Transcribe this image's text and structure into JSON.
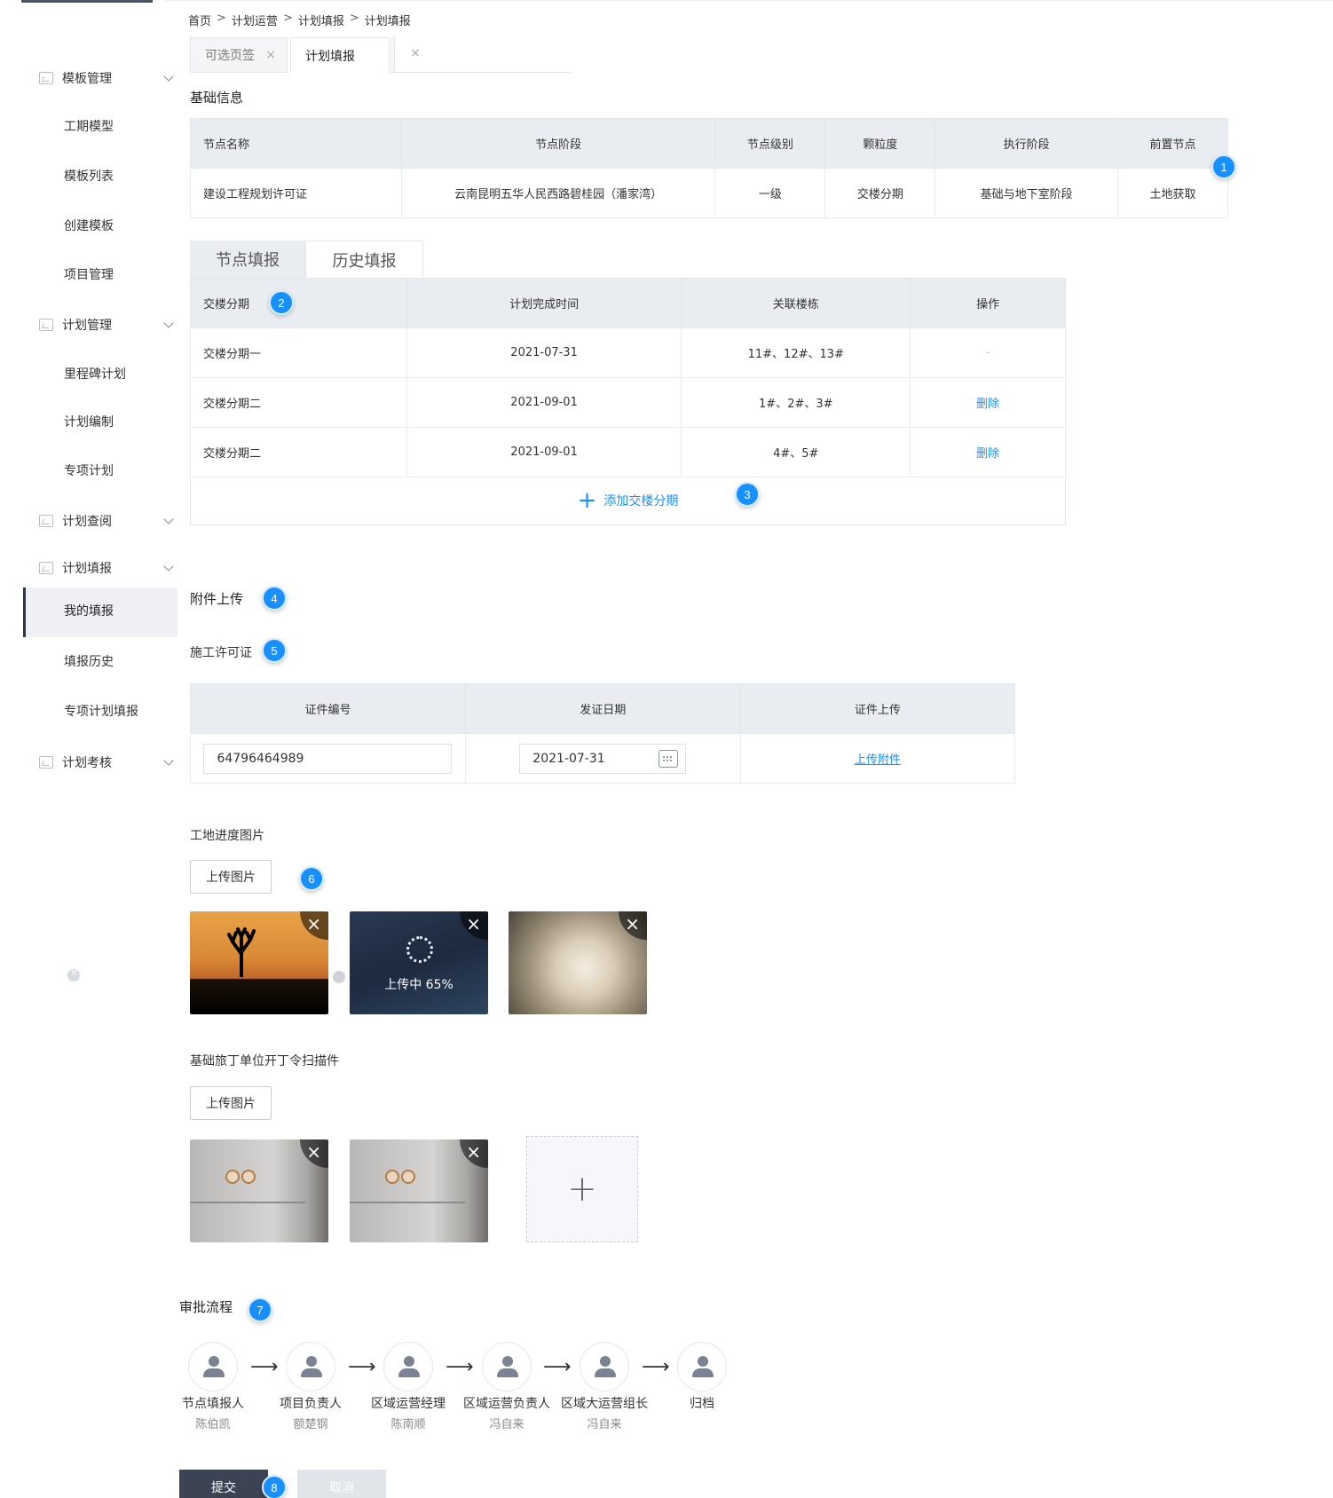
{
  "breadcrumb": [
    "首页",
    "计划运营",
    "计划填报",
    "计划填报"
  ],
  "breadcrumb_sep": ">",
  "tabs": [
    {
      "label": "可选页签"
    },
    {
      "label": "计划填报"
    }
  ],
  "sidebar": {
    "groups": [
      {
        "label": "模板管理",
        "items": [
          "工期模型",
          "模板列表",
          "创建模板",
          "项目管理"
        ]
      },
      {
        "label": "计划管理",
        "items": [
          "里程碑计划",
          "计划编制",
          "专项计划"
        ]
      },
      {
        "label": "计划查阅",
        "items": []
      },
      {
        "label": "计划填报",
        "items": [
          "我的填报",
          "填报历史",
          "专项计划填报"
        ]
      },
      {
        "label": "计划考核",
        "items": []
      }
    ],
    "active_item": "我的填报"
  },
  "basic_info": {
    "title": "基础信息",
    "headers": [
      "节点名称",
      "节点阶段",
      "节点级别",
      "颗粒度",
      "执行阶段",
      "前置节点"
    ],
    "row": [
      "建设工程规划许可证",
      "云南昆明五华人民西路碧桂园（潘家湾）",
      "一级",
      "交楼分期",
      "基础与地下室阶段",
      "土地获取"
    ]
  },
  "node_tabs": [
    "节点填报",
    "历史填报"
  ],
  "node_table": {
    "headers": [
      "交楼分期",
      "计划完成时间",
      "关联楼栋",
      "操作"
    ],
    "rows": [
      [
        "交楼分期一",
        "2021-07-31",
        "11#、12#、13#",
        "-"
      ],
      [
        "交楼分期二",
        "2021-09-01",
        "1#、2#、3#",
        "删除"
      ],
      [
        "交楼分期二",
        "2021-09-01",
        "4#、5#",
        "删除"
      ]
    ],
    "add_label": "添加交楼分期"
  },
  "attachments": {
    "title": "附件上传",
    "permit_title": "施工许可证",
    "permit_headers": [
      "证件编号",
      "发证日期",
      "证件上传"
    ],
    "permit_number": "64796464989",
    "permit_date": "2021-07-31",
    "permit_upload": "上传附件",
    "progress_title": "工地进度图片",
    "upload_button": "上传图片",
    "uploading_text": "上传中  65%",
    "scan_title": "基础旅丁单位开丁令扫描件",
    "scan_upload_button": "上传图片"
  },
  "workflow": {
    "title": "审批流程",
    "steps": [
      {
        "role": "节点填报人",
        "name": "陈伯凯"
      },
      {
        "role": "项目负责人",
        "name": "额楚钢"
      },
      {
        "role": "区域运营经理",
        "name": "陈南顺"
      },
      {
        "role": "区域运营负责人",
        "name": "冯自来"
      },
      {
        "role": "区域大运营组长",
        "name": "冯自来"
      },
      {
        "role": "归档",
        "name": ""
      }
    ],
    "arrow": "⟶"
  },
  "actions": {
    "submit": "提交",
    "cancel": "取消"
  },
  "callouts": [
    "1",
    "2",
    "3",
    "4",
    "5",
    "6",
    "7",
    "8"
  ],
  "colors": {
    "accent": "#1890ff",
    "header_bg": "#e9edf2",
    "submit_bg": "#3c4454"
  }
}
